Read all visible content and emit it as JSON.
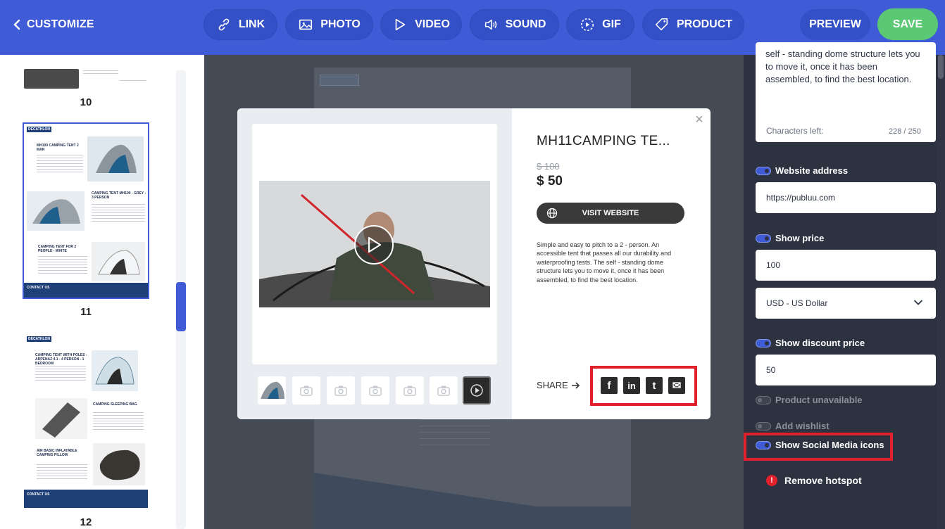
{
  "topbar": {
    "back_label": "CUSTOMIZE",
    "tools": [
      {
        "label": "LINK",
        "icon": "link-icon"
      },
      {
        "label": "PHOTO",
        "icon": "photo-icon"
      },
      {
        "label": "VIDEO",
        "icon": "video-icon"
      },
      {
        "label": "SOUND",
        "icon": "sound-icon"
      },
      {
        "label": "GIF",
        "icon": "gif-icon"
      },
      {
        "label": "PRODUCT",
        "icon": "tag-icon"
      }
    ],
    "preview_label": "PREVIEW",
    "save_label": "SAVE",
    "accent": "#3f5bd6",
    "save_color": "#5bc873"
  },
  "pages": {
    "numbers": [
      "10",
      "11",
      "12"
    ],
    "thumb11": {
      "brand": "DECATHLON",
      "t1": "MH100 CAMPING TENT 2 MAN",
      "t2": "CAMPING TENT MH100 - GREY - 3 PERSON",
      "t3": "CAMPING TENT FOR 2 PEOPLE - WHITE",
      "contact": "CONTACT US"
    },
    "thumb12": {
      "brand": "DECATHLON",
      "t1": "CAMPING TENT WITH POLES - ARPENAZ 4.1 - 4 PERSON - 1 BEDROOM",
      "t2": "CAMPING SLEEPING BAG",
      "t3": "AIR BASIC INFLATABLE CAMPING PILLOW",
      "contact": "CONTACT US"
    }
  },
  "modal": {
    "close_glyph": "×",
    "title": "MH11CAMPING TE...",
    "old_price": "$ 100",
    "new_price": "$ 50",
    "visit_label": "VISIT WEBSITE",
    "description": "Simple and easy to pitch to a 2 - person. An accessible tent that passes all our durability and waterproofing tests. The self - standing dome structure lets you to move it, once it has been assembled, to find the best location.",
    "share_label": "SHARE",
    "social": [
      {
        "name": "facebook-icon",
        "glyph": "f"
      },
      {
        "name": "linkedin-icon",
        "glyph": "in"
      },
      {
        "name": "twitter-icon",
        "glyph": "t"
      },
      {
        "name": "email-icon",
        "glyph": "✉"
      }
    ]
  },
  "panel": {
    "description_text": "self - standing dome structure lets you to move it, once it has been assembled, to find the best location.",
    "chars_label": "Characters left:",
    "chars_value": "228 / 250",
    "website_label": "Website address",
    "website_value": "https://publuu.com",
    "price_label": "Show price",
    "price_value": "100",
    "currency_value": "USD - US Dollar",
    "discount_label": "Show discount price",
    "discount_value": "50",
    "unavailable_label": "Product unavailable",
    "wishlist_label": "Add wishlist",
    "social_label": "Show Social Media icons",
    "remove_label": "Remove hotspot",
    "highlight_color": "#e0202a"
  }
}
